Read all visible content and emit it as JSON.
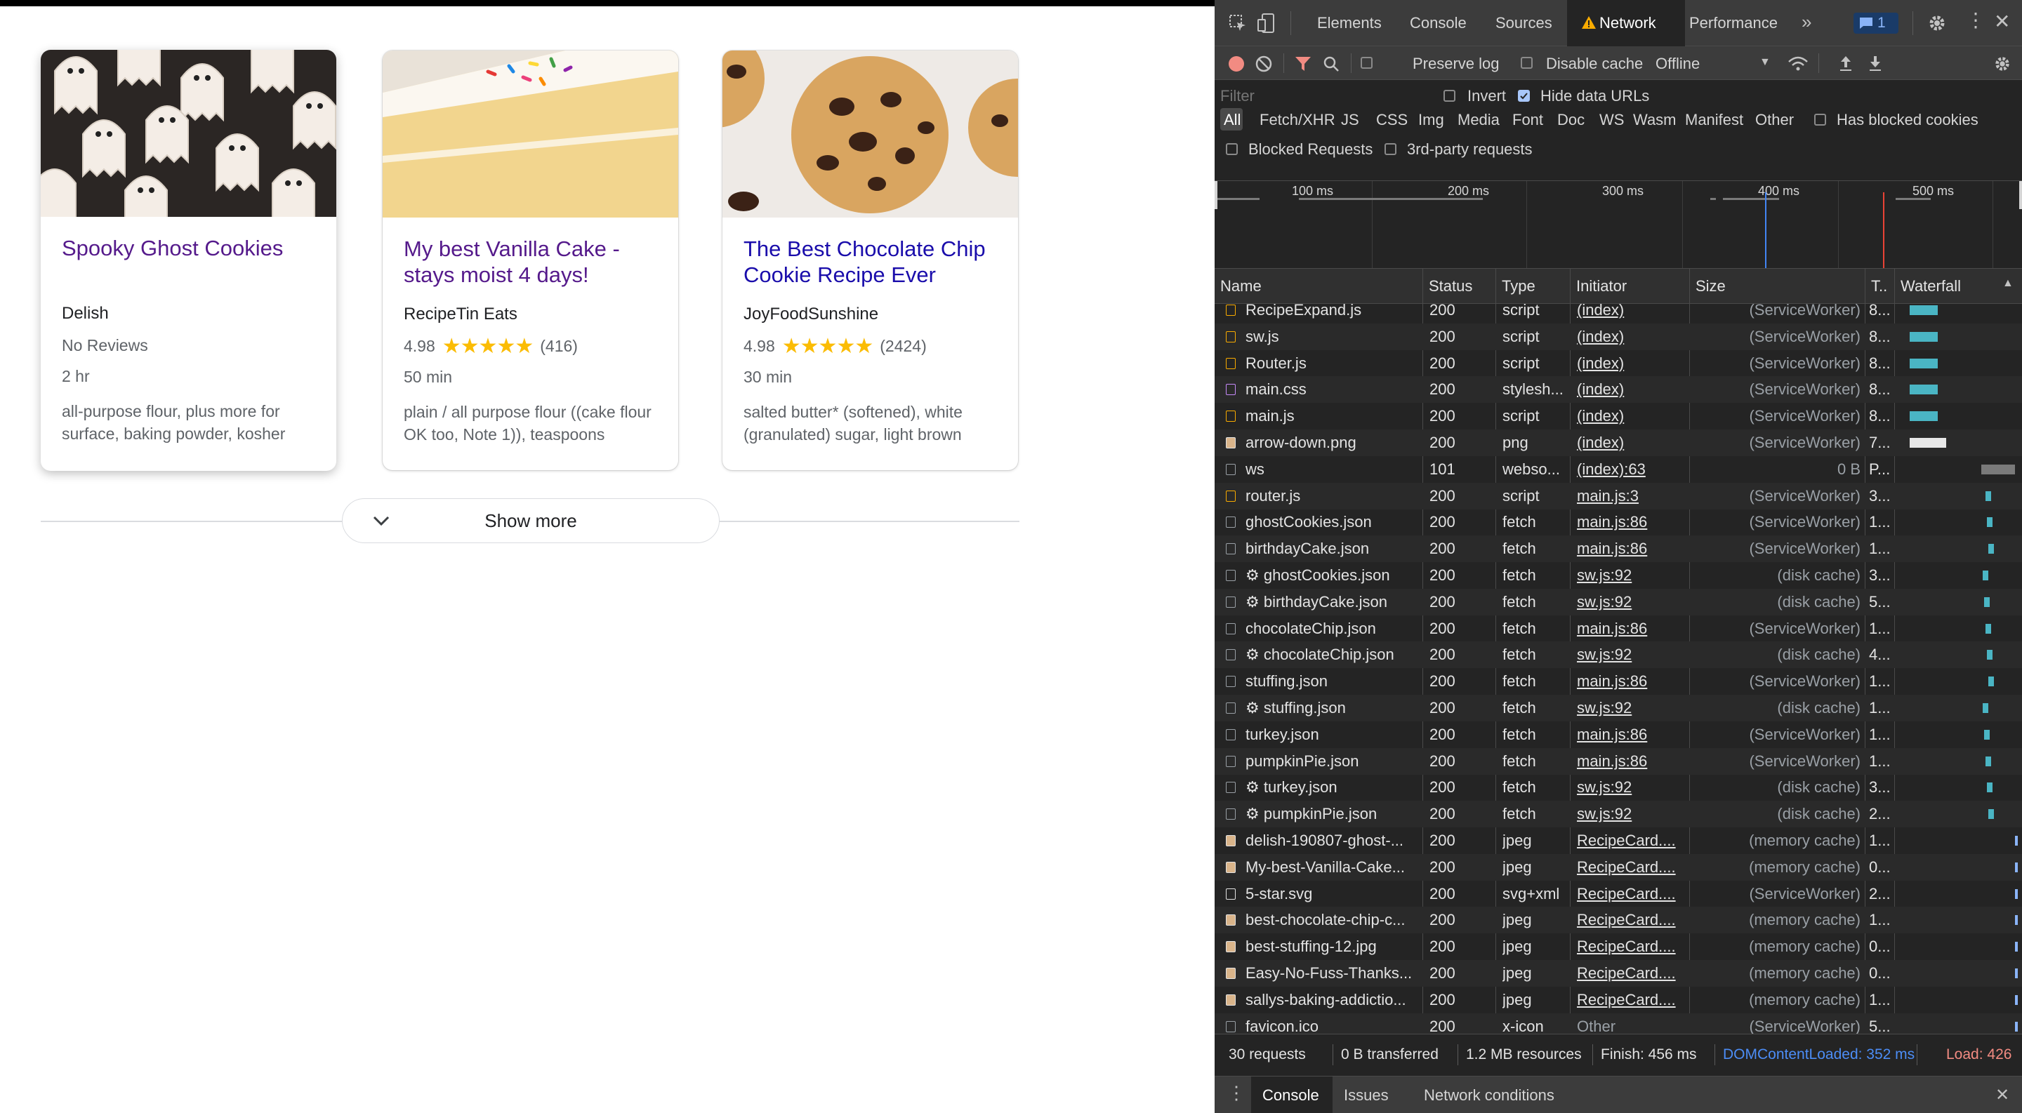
{
  "page": {
    "cards": [
      {
        "title": "Spooky Ghost Cookies",
        "source": "Delish",
        "reviews": "No Reviews",
        "time": "2 hr",
        "ingredients": "all-purpose flour, plus more for surface, baking powder, kosher"
      },
      {
        "title": "My best Vanilla Cake - stays moist 4 days!",
        "source": "RecipeTin Eats",
        "rating": "4.98",
        "stars": "★★★★★",
        "count": "(416)",
        "time": "50 min",
        "ingredients": "plain / all purpose flour ((cake flour OK too, Note 1)), teaspoons"
      },
      {
        "title": "The Best Chocolate Chip Cookie Recipe Ever",
        "source": "JoyFoodSunshine",
        "rating": "4.98",
        "stars": "★★★★★",
        "count": "(2424)",
        "time": "30 min",
        "ingredients": "salted butter* (softened), white (granulated) sugar, light brown"
      }
    ],
    "show_more": "Show more"
  },
  "devtools": {
    "tabs": [
      "Elements",
      "Console",
      "Sources",
      "Network",
      "Performance"
    ],
    "active_tab": "Network",
    "issues_badge": "1",
    "toolbar": {
      "preserve_log": "Preserve log",
      "disable_cache": "Disable cache",
      "throttle": "Offline"
    },
    "filter": {
      "placeholder": "Filter",
      "invert": "Invert",
      "hide_data_urls": "Hide data URLs",
      "has_blocked_cookies": "Has blocked cookies",
      "blocked_requests": "Blocked Requests",
      "third_party": "3rd-party requests"
    },
    "type_filters": [
      "All",
      "Fetch/XHR",
      "JS",
      "CSS",
      "Img",
      "Media",
      "Font",
      "Doc",
      "WS",
      "Wasm",
      "Manifest",
      "Other"
    ],
    "timeline_ticks": [
      "100 ms",
      "200 ms",
      "300 ms",
      "400 ms",
      "500 ms"
    ],
    "columns": [
      "Name",
      "Status",
      "Type",
      "Initiator",
      "Size",
      "T..",
      "Waterfall"
    ],
    "requests": [
      {
        "name": "RecipeExpand.js",
        "status": "200",
        "type": "script",
        "initiator": "(index)",
        "size": "(ServiceWorker)",
        "time": "8...",
        "icon": "js"
      },
      {
        "name": "sw.js",
        "status": "200",
        "type": "script",
        "initiator": "(index)",
        "size": "(ServiceWorker)",
        "time": "8...",
        "icon": "js"
      },
      {
        "name": "Router.js",
        "status": "200",
        "type": "script",
        "initiator": "(index)",
        "size": "(ServiceWorker)",
        "time": "8...",
        "icon": "js"
      },
      {
        "name": "main.css",
        "status": "200",
        "type": "stylesh...",
        "initiator": "(index)",
        "size": "(ServiceWorker)",
        "time": "8...",
        "icon": "css"
      },
      {
        "name": "main.js",
        "status": "200",
        "type": "script",
        "initiator": "(index)",
        "size": "(ServiceWorker)",
        "time": "8...",
        "icon": "js"
      },
      {
        "name": "arrow-down.png",
        "status": "200",
        "type": "png",
        "initiator": "(index)",
        "size": "(ServiceWorker)",
        "time": "7...",
        "icon": "img"
      },
      {
        "name": "ws",
        "status": "101",
        "type": "webso...",
        "initiator": "(index):63",
        "size": "0 B",
        "time": "P...",
        "icon": "doc"
      },
      {
        "name": "router.js",
        "status": "200",
        "type": "script",
        "initiator": "main.js:3",
        "size": "(ServiceWorker)",
        "time": "3...",
        "icon": "js"
      },
      {
        "name": "ghostCookies.json",
        "status": "200",
        "type": "fetch",
        "initiator": "main.js:86",
        "size": "(ServiceWorker)",
        "time": "1...",
        "icon": "doc"
      },
      {
        "name": "birthdayCake.json",
        "status": "200",
        "type": "fetch",
        "initiator": "main.js:86",
        "size": "(ServiceWorker)",
        "time": "1...",
        "icon": "doc"
      },
      {
        "name": "⚙ ghostCookies.json",
        "status": "200",
        "type": "fetch",
        "initiator": "sw.js:92",
        "size": "(disk cache)",
        "time": "3...",
        "icon": "doc"
      },
      {
        "name": "⚙ birthdayCake.json",
        "status": "200",
        "type": "fetch",
        "initiator": "sw.js:92",
        "size": "(disk cache)",
        "time": "5...",
        "icon": "doc"
      },
      {
        "name": "chocolateChip.json",
        "status": "200",
        "type": "fetch",
        "initiator": "main.js:86",
        "size": "(ServiceWorker)",
        "time": "1...",
        "icon": "doc"
      },
      {
        "name": "⚙ chocolateChip.json",
        "status": "200",
        "type": "fetch",
        "initiator": "sw.js:92",
        "size": "(disk cache)",
        "time": "4...",
        "icon": "doc"
      },
      {
        "name": "stuffing.json",
        "status": "200",
        "type": "fetch",
        "initiator": "main.js:86",
        "size": "(ServiceWorker)",
        "time": "1...",
        "icon": "doc"
      },
      {
        "name": "⚙ stuffing.json",
        "status": "200",
        "type": "fetch",
        "initiator": "sw.js:92",
        "size": "(disk cache)",
        "time": "1...",
        "icon": "doc"
      },
      {
        "name": "turkey.json",
        "status": "200",
        "type": "fetch",
        "initiator": "main.js:86",
        "size": "(ServiceWorker)",
        "time": "1...",
        "icon": "doc"
      },
      {
        "name": "pumpkinPie.json",
        "status": "200",
        "type": "fetch",
        "initiator": "main.js:86",
        "size": "(ServiceWorker)",
        "time": "1...",
        "icon": "doc"
      },
      {
        "name": "⚙ turkey.json",
        "status": "200",
        "type": "fetch",
        "initiator": "sw.js:92",
        "size": "(disk cache)",
        "time": "3...",
        "icon": "doc"
      },
      {
        "name": "⚙ pumpkinPie.json",
        "status": "200",
        "type": "fetch",
        "initiator": "sw.js:92",
        "size": "(disk cache)",
        "time": "2...",
        "icon": "doc"
      },
      {
        "name": "delish-190807-ghost-...",
        "status": "200",
        "type": "jpeg",
        "initiator": "RecipeCard....",
        "size": "(memory cache)",
        "time": "1...",
        "icon": "img"
      },
      {
        "name": "My-best-Vanilla-Cake...",
        "status": "200",
        "type": "jpeg",
        "initiator": "RecipeCard....",
        "size": "(memory cache)",
        "time": "0...",
        "icon": "img"
      },
      {
        "name": "5-star.svg",
        "status": "200",
        "type": "svg+xml",
        "initiator": "RecipeCard....",
        "size": "(ServiceWorker)",
        "time": "2...",
        "icon": "svg"
      },
      {
        "name": "best-chocolate-chip-c...",
        "status": "200",
        "type": "jpeg",
        "initiator": "RecipeCard....",
        "size": "(memory cache)",
        "time": "1...",
        "icon": "img"
      },
      {
        "name": "best-stuffing-12.jpg",
        "status": "200",
        "type": "jpeg",
        "initiator": "RecipeCard....",
        "size": "(memory cache)",
        "time": "0...",
        "icon": "img"
      },
      {
        "name": "Easy-No-Fuss-Thanks...",
        "status": "200",
        "type": "jpeg",
        "initiator": "RecipeCard....",
        "size": "(memory cache)",
        "time": "0...",
        "icon": "img"
      },
      {
        "name": "sallys-baking-addictio...",
        "status": "200",
        "type": "jpeg",
        "initiator": "RecipeCard....",
        "size": "(memory cache)",
        "time": "1...",
        "icon": "img"
      },
      {
        "name": "favicon.ico",
        "status": "200",
        "type": "x-icon",
        "initiator": "Other",
        "size": "(ServiceWorker)",
        "time": "5...",
        "icon": "doc"
      }
    ],
    "status_bar": {
      "requests": "30 requests",
      "transferred": "0 B transferred",
      "resources": "1.2 MB resources",
      "finish": "Finish: 456 ms",
      "dcl": "DOMContentLoaded: 352 ms",
      "load": "Load: 426"
    },
    "drawer_tabs": [
      "Console",
      "Issues",
      "Network conditions"
    ],
    "colors": {
      "accent": "#8ab4f8",
      "dcl": "#4285f4",
      "load": "#ea4335",
      "star": "#fbbc04"
    }
  }
}
